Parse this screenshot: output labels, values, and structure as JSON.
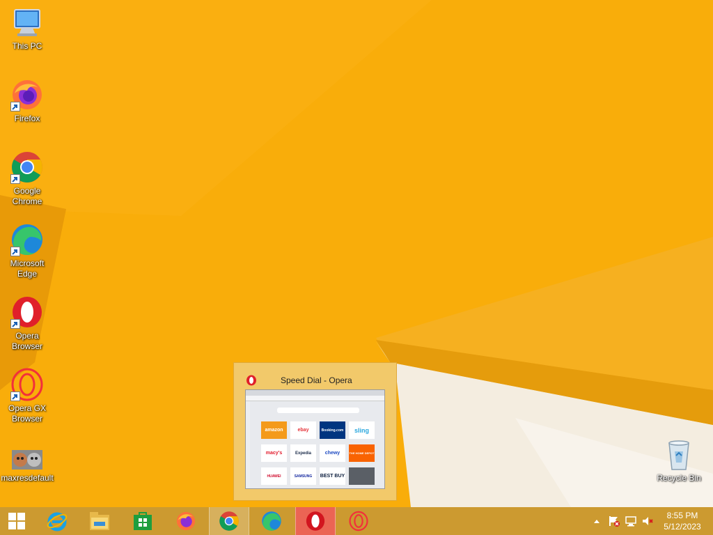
{
  "desktop": {
    "icons": [
      {
        "label": "This PC",
        "icon": "this-pc-icon"
      },
      {
        "label": "Firefox",
        "icon": "firefox-icon"
      },
      {
        "label": "Google Chrome",
        "icon": "chrome-icon"
      },
      {
        "label": "Microsoft Edge",
        "icon": "edge-icon"
      },
      {
        "label": "Opera Browser",
        "icon": "opera-icon"
      },
      {
        "label": "Opera GX Browser",
        "icon": "opera-gx-icon"
      },
      {
        "label": "maxresdefault",
        "icon": "image-file-icon"
      },
      {
        "label": "Recycle Bin",
        "icon": "recycle-bin-icon"
      }
    ]
  },
  "thumbnail_popup": {
    "title": "Speed Dial - Opera",
    "speed_dial": [
      "amazon",
      "ebay",
      "Booking.com",
      "sling",
      "macy's",
      "Expedia",
      "chewy",
      "THE HOME DEPOT",
      "HUAWEI",
      "SAMSUNG",
      "BEST BUY",
      ""
    ]
  },
  "taskbar": {
    "items": [
      "Start",
      "Internet Explorer",
      "File Explorer",
      "Store",
      "Firefox",
      "Google Chrome",
      "Microsoft Edge",
      "Opera",
      "Opera GX"
    ],
    "active_item": "Opera"
  },
  "tray": {
    "time": "8:55 PM",
    "date": "5/12/2023",
    "icons": [
      "show-hidden-icons-chevron-icon",
      "action-center-flag-icon",
      "network-icon",
      "volume-muted-icon"
    ]
  },
  "colors": {
    "wallpaper": "#f9ad0a",
    "taskbar": "#c89834",
    "opera_red": "#e0202a"
  }
}
